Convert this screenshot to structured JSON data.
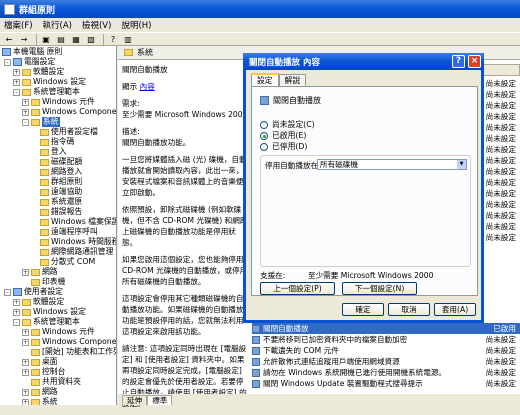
{
  "window": {
    "title": "群組原則"
  },
  "menu": [
    "檔案(F)",
    "執行(A)",
    "檢視(V)",
    "說明(H)"
  ],
  "tree": {
    "root": "本機電腦 原則",
    "computer_config": "電腦設定",
    "software_settings": "軟體設定",
    "windows_settings": "Windows 設定",
    "admin_templates": "系統管理範本",
    "windows_components": "Windows 元件",
    "windows_components2": "Windows Components",
    "system": "系統",
    "system_items": [
      "使用者設定檔",
      "指令碼",
      "登入",
      "磁碟配額",
      "網路登入",
      "群組原則",
      "遠端協助",
      "系統還原",
      "錯誤報告",
      "Windows 檔案保護",
      "遠端程序呼叫",
      "Windows 時間服務",
      "網際網路通訊管理",
      "分散式 COM"
    ],
    "network": "網路",
    "printers": "印表機",
    "user_config": "使用者設定",
    "u_software": "軟體設定",
    "u_windows": "Windows 設定",
    "u_admin": "系統管理範本",
    "u_items": [
      "Windows 元件",
      "Windows Components",
      "[開始] 功能表和工作列",
      "桌面",
      "控制台",
      "共用資料夾",
      "網路",
      "系統"
    ]
  },
  "right": {
    "header": "系統",
    "desc_title": "關閉自動播放",
    "show_label": "顯示",
    "show_link": "內容",
    "req_label": "需求:",
    "req_text": "至少需要 Microsoft Windows 2000",
    "desc_label": "描述:",
    "desc_p1": "關閉自動播放功能。",
    "desc_p2": "一旦您將媒體插入磁 (光) 碟機，自動播放就會開始讀取內容，此出一來，安裝程式檔案和音訊媒體上的音樂便立即啟動。",
    "desc_p3": "依照預設，卸除式磁碟機 (例如軟碟機，但不含 CD-ROM 光碟機) 和網路上磁碟機的自動播放功能是停用狀態。",
    "desc_p4": "如果您啟用這個設定，您也能夠停用 CD-ROM 光碟機的自動播放，或停用所有磁碟機的自動播放。",
    "desc_p5": "這項設定會停用其它種類磁碟機的自動播放功能。如果磁碟機的自動播放功能是預設停用的話，您就無法利用這項設定來啟用該功能。",
    "desc_p6": "請注意: 這項設定同時出現在 [電腦設定] 和 [使用者設定] 資料夾中。如果兩項設定同時設定完成，[電腦設定] 的設定會優先於使用者設定。若要停止自動播放，請使用 [使用者設定] 的設定。",
    "state_header": "狀態",
    "right_states": [
      "尚未設定",
      "尚未設定",
      "尚未設定",
      "尚未設定",
      "尚未設定",
      "尚未設定",
      "尚未設定",
      "尚未設定",
      "尚未設定",
      "尚未設定",
      "尚未設定",
      "尚未設定",
      "尚未設定",
      "尚未設定",
      "尚未設定"
    ],
    "bottom_rows": [
      {
        "label": "關閉自動播放",
        "state": "已啟用"
      },
      {
        "label": "不要將移到已加密資料夾中的檔案自動加密",
        "state": "尚未設定"
      },
      {
        "label": "下載遺失的 COM 元件",
        "state": "尚未設定"
      },
      {
        "label": "允許散佈式連結追蹤用戶端使用網域資源",
        "state": "尚未設定"
      },
      {
        "label": "請勿在 Windows 系統開機已進行使用開機系統電源。",
        "state": "尚未設定"
      },
      {
        "label": "關閉 Windows Update 裝置驅動程式搜尋提示",
        "state": "尚未設定"
      }
    ],
    "tabs": [
      "延伸",
      "標準"
    ]
  },
  "dialog": {
    "title": "關閉自動播放 內容",
    "help": "?",
    "close": "×",
    "tabs": [
      "設定",
      "解說"
    ],
    "policy_name": "關閉自動播放",
    "radio_not_configured": "尚未設定(C)",
    "radio_enabled": "已啟用(E)",
    "radio_disabled": "已停用(D)",
    "enabled_selected": true,
    "select_label": "停用自動播放在:",
    "select_value": "所有磁碟機",
    "supported_label": "支援在:",
    "supported_value": "至少需要 Microsoft Windows 2000",
    "prev_button": "上一個設定(P)",
    "next_button": "下一個設定(N)",
    "ok": "確定",
    "cancel": "取消",
    "apply": "套用(A)"
  }
}
